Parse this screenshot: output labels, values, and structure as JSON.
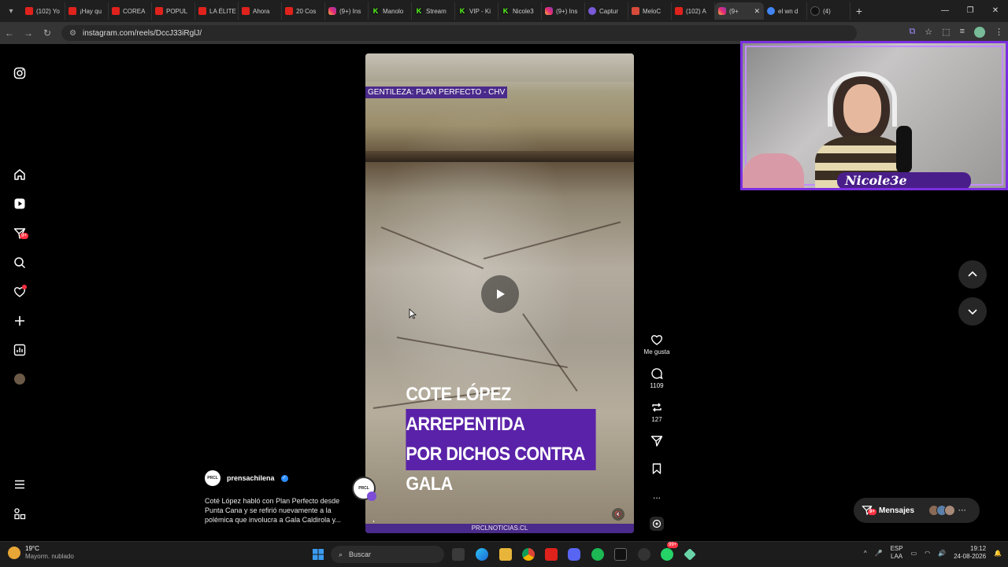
{
  "browser": {
    "tabs": [
      {
        "title": "(102) Yo",
        "icon": "youtube-icon"
      },
      {
        "title": "¡Hay qu",
        "icon": "youtube-icon"
      },
      {
        "title": "COREA",
        "icon": "youtube-icon"
      },
      {
        "title": "POPUL",
        "icon": "youtube-icon"
      },
      {
        "title": "LA ÉLITE",
        "icon": "youtube-icon"
      },
      {
        "title": "Ahora",
        "icon": "youtube-icon"
      },
      {
        "title": "20 Cos",
        "icon": "youtube-icon"
      },
      {
        "title": "(9+) Ins",
        "icon": "instagram-icon"
      },
      {
        "title": "Manolo",
        "icon": "kick-icon"
      },
      {
        "title": "Stream",
        "icon": "kick-icon"
      },
      {
        "title": "VIP - Ki",
        "icon": "kick-icon"
      },
      {
        "title": "Nicole3",
        "icon": "kick-icon"
      },
      {
        "title": "(9+) Ins",
        "icon": "instagram-icon"
      },
      {
        "title": "Captur",
        "icon": "capture-icon"
      },
      {
        "title": "MeloC",
        "icon": "gmail-icon"
      },
      {
        "title": "(102) A",
        "icon": "youtube-icon"
      },
      {
        "title": "(9+",
        "icon": "instagram-icon",
        "active": true
      },
      {
        "title": "el wn d",
        "icon": "google-icon"
      },
      {
        "title": "(4)",
        "icon": "tiktok-icon"
      }
    ],
    "url": "instagram.com/reels/DccJ33iRglJ/"
  },
  "reel": {
    "credit": "GENTILEZA: PLAN PERFECTO - CHV",
    "headline_line1": "COTE LÓPEZ ARREPENTIDA",
    "headline_line2": "POR DICHOS CONTRA GALA",
    "footer": "PRCLNOTICIAS.CL",
    "author": "prensachilena",
    "avatar_text": "PRCL",
    "caption": "Coté López habló con Plan Perfecto desde Punta Cana y se refirió nuevamente a la polémica que involucra a Gala Caldirola y...",
    "like_label": "Me gusta",
    "comments_count": "1109",
    "reposts_count": "127",
    "more_label": "..."
  },
  "nav": {
    "notifications_badge": "9+"
  },
  "messages": {
    "label": "Mensajes",
    "badge": "9+"
  },
  "webcam": {
    "streamer_name": "Nicole3e"
  },
  "taskbar": {
    "temperature": "19°C",
    "weather_desc": "Mayorm. nublado",
    "search_placeholder": "Buscar",
    "lang_line1": "ESP",
    "lang_line2": "LAA",
    "time": "19:12",
    "date": "24-08-2026",
    "whatsapp_badge": "99+"
  },
  "colors": {
    "accent_purple": "#5a22a8",
    "ig_red": "#ff3040"
  }
}
